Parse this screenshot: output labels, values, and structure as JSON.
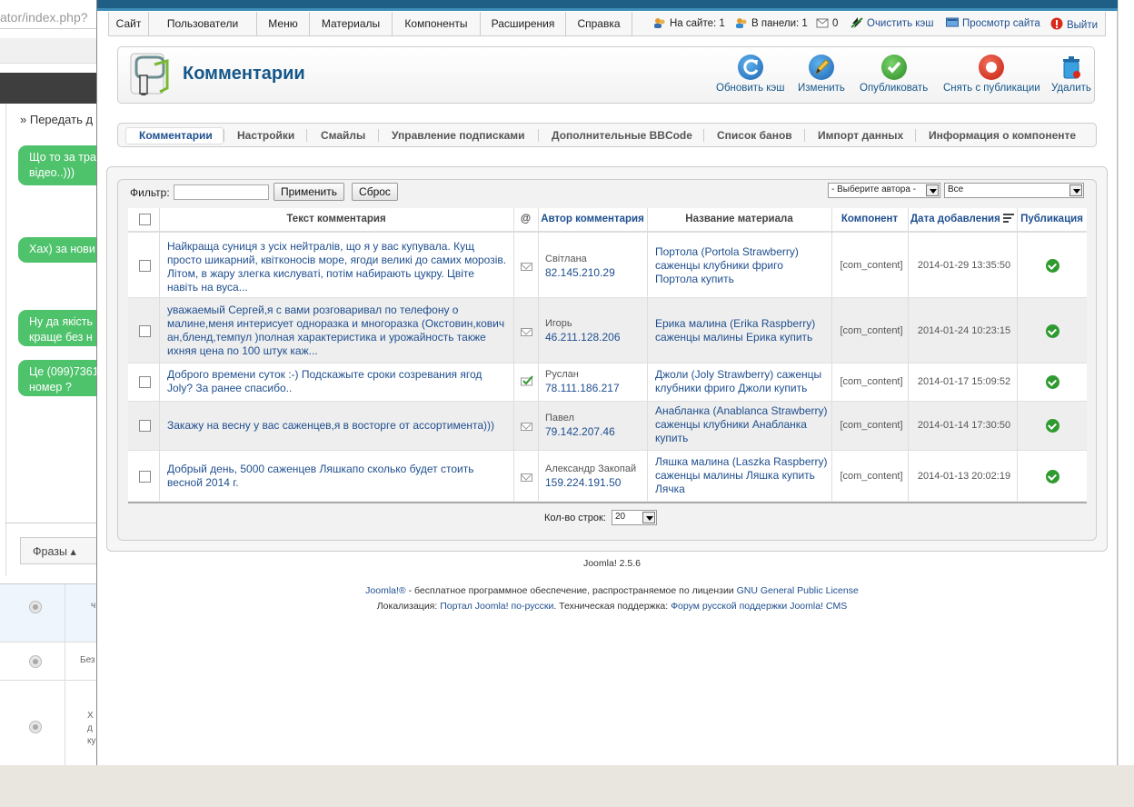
{
  "background_window": {
    "url_fragment": "ator/index.php?",
    "forward_label": "Передать д",
    "messages": [
      "Що то за тра відео..)))",
      "Хах) за нови",
      "Ну да якість краще без н",
      "Це (099)7361 номер ?"
    ],
    "phrases_label": "Фразы",
    "row_texts": [
      "ч",
      "Без",
      "Х д ку"
    ]
  },
  "menu": {
    "items": [
      "Сайт",
      "Пользователи",
      "Меню",
      "Материалы",
      "Компоненты",
      "Расширения",
      "Справка"
    ]
  },
  "status": {
    "on_site": "На сайте: 1",
    "in_panel": "В панели: 1",
    "messages": "0",
    "clear_cache": "Очистить кэш",
    "view_site": "Просмотр сайта",
    "logout": "Выйти"
  },
  "toolbar": {
    "title": "Комментарии",
    "refresh_cache": "Обновить кэш",
    "edit": "Изменить",
    "publish": "Опубликовать",
    "unpublish": "Снять с публикации",
    "delete": "Удалить"
  },
  "subnav": {
    "tabs": [
      "Комментарии",
      "Настройки",
      "Смайлы",
      "Управление подписками",
      "Дополнительные BBCode",
      "Список банов",
      "Импорт данных",
      "Информация о компоненте"
    ]
  },
  "filter": {
    "label": "Фильтр:",
    "value": "",
    "apply": "Применить",
    "reset": "Сброс",
    "author_select": "- Выберите автора -",
    "state_select": "Все"
  },
  "table": {
    "headers": {
      "text": "Текст комментария",
      "at": "@",
      "author": "Автор комментария",
      "title": "Название материала",
      "component": "Компонент",
      "date": "Дата добавления",
      "published": "Публикация"
    },
    "rows": [
      {
        "text": "Найкраща суниця з усіх нейтралів, що я у вас купувала. Кущ просто шикарний, квітконосів море, ягоди великі до самих морозів. Літом, в жару злегка кислуваті, потім набирають цукру. Цвіте навіть на вуса...",
        "author": "Світлана",
        "ip": "82.145.210.29",
        "title": "Портола (Portola Strawberry) саженцы клубники фриго Портола купить",
        "component": "[com_content]",
        "date": "2014-01-29 13:35:50",
        "subscribed": false
      },
      {
        "text": "уважаемый Сергей,я с вами розговаривал по телефону о малине,меня интерисует одноразка и многоразка (Окстовин,кович ан,бленд,темпул )полная характеристика и урожайность также ихняя цена по 100 штук каж...",
        "author": "Игорь",
        "ip": "46.211.128.206",
        "title": "Ерика малина (Erika Raspberry) саженцы малины Ерика купить",
        "component": "[com_content]",
        "date": "2014-01-24 10:23:15",
        "subscribed": false
      },
      {
        "text": "Доброго времени суток :-) Подскажыте сроки созревания ягод Joly? За ранее спасибо..",
        "author": "Руслан",
        "ip": "78.111.186.217",
        "title": "Джоли (Joly Strawberry) саженцы клубники фриго Джоли купить",
        "component": "[com_content]",
        "date": "2014-01-17 15:09:52",
        "subscribed": true
      },
      {
        "text": "Закажу на весну у вас саженцев,я в восторге от ассортимента)))",
        "author": "Павел",
        "ip": "79.142.207.46",
        "title": "Анабланка (Anablanca Strawberry) саженцы клубники Анабланка купить",
        "component": "[com_content]",
        "date": "2014-01-14 17:30:50",
        "subscribed": false
      },
      {
        "text": "Добрый день, 5000 саженцев Ляшкапо сколько будет стоить весной 2014 г.",
        "author": "Александр Закопай",
        "ip": "159.224.191.50",
        "title": "Ляшка малина (Laszka Raspberry) саженцы малины Ляшка купить Лячка",
        "component": "[com_content]",
        "date": "2014-01-13 20:02:19",
        "subscribed": false
      }
    ],
    "rows_label": "Кол-во строк:",
    "rows_value": "20"
  },
  "footer": {
    "version": "Joomla! 2.5.6",
    "joomla_link": "Joomla!®",
    "license_text": " - бесплатное программное обеспечение, распространяемое по лицензии ",
    "license_link": "GNU General Public License",
    "localization_label": "Локализация: ",
    "portal_link": "Портал Joomla! по-русски",
    "support_label": ". Техническая поддержка: ",
    "forum_link": "Форум русской поддержки Joomla! CMS"
  },
  "colors": {
    "accent": "#16578a",
    "topbar": "#1f5f86",
    "chat_bubble": "#4fc26c",
    "publish_ok": "#2f9a2f"
  }
}
